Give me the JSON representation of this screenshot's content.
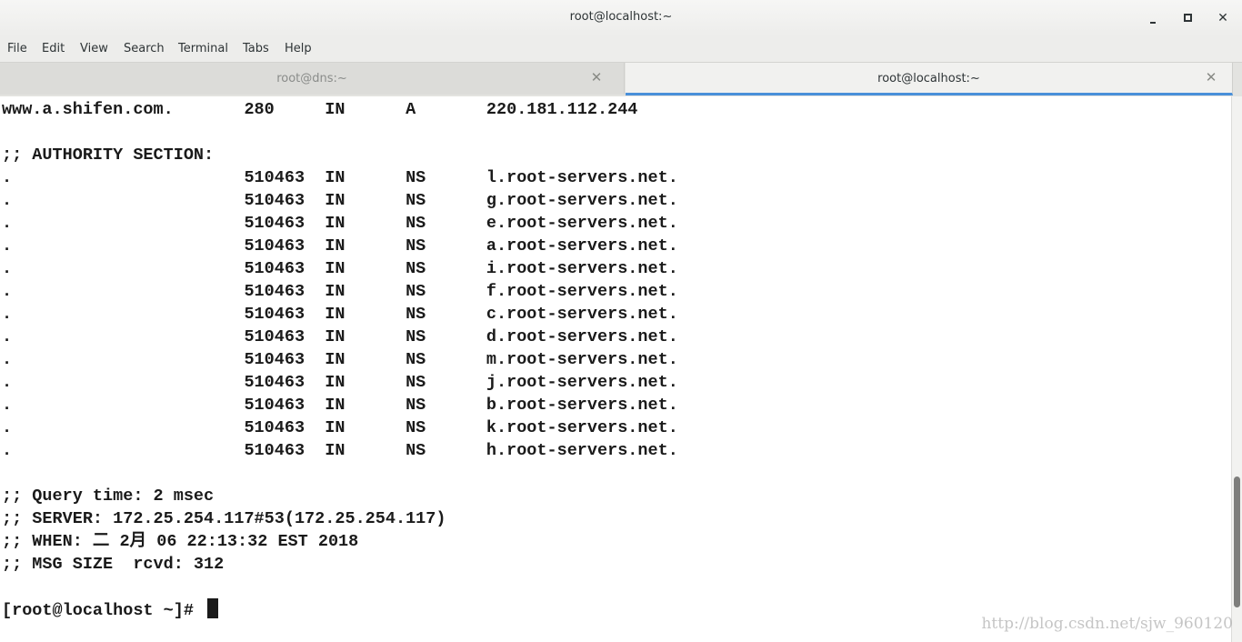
{
  "window": {
    "title": "root@localhost:~",
    "controls": {
      "minimize": "minimize-icon",
      "maximize": "maximize-icon",
      "close": "close-icon"
    }
  },
  "menubar": {
    "items": [
      "File",
      "Edit",
      "View",
      "Search",
      "Terminal",
      "Tabs",
      "Help"
    ]
  },
  "tabs": [
    {
      "label": "root@dns:~",
      "active": false
    },
    {
      "label": "root@localhost:~",
      "active": true
    }
  ],
  "terminal": {
    "lines": [
      "www.a.shifen.com.       280     IN      A       220.181.112.244",
      "",
      ";; AUTHORITY SECTION:",
      ".                       510463  IN      NS      l.root-servers.net.",
      ".                       510463  IN      NS      g.root-servers.net.",
      ".                       510463  IN      NS      e.root-servers.net.",
      ".                       510463  IN      NS      a.root-servers.net.",
      ".                       510463  IN      NS      i.root-servers.net.",
      ".                       510463  IN      NS      f.root-servers.net.",
      ".                       510463  IN      NS      c.root-servers.net.",
      ".                       510463  IN      NS      d.root-servers.net.",
      ".                       510463  IN      NS      m.root-servers.net.",
      ".                       510463  IN      NS      j.root-servers.net.",
      ".                       510463  IN      NS      b.root-servers.net.",
      ".                       510463  IN      NS      k.root-servers.net.",
      ".                       510463  IN      NS      h.root-servers.net.",
      "",
      ";; Query time: 2 msec",
      ";; SERVER: 172.25.254.117#53(172.25.254.117)",
      ";; WHEN: 二 2月 06 22:13:32 EST 2018",
      ";; MSG SIZE  rcvd: 312",
      ""
    ],
    "prompt": "[root@localhost ~]# "
  },
  "scrollbar": {
    "position": 0.92,
    "visible_fraction": 0.24
  },
  "watermark": "http://blog.csdn.net/sjw_960120",
  "colors": {
    "accent": "#4a90d9",
    "text": "#1a1a1a",
    "chrome": "#ededeb"
  }
}
